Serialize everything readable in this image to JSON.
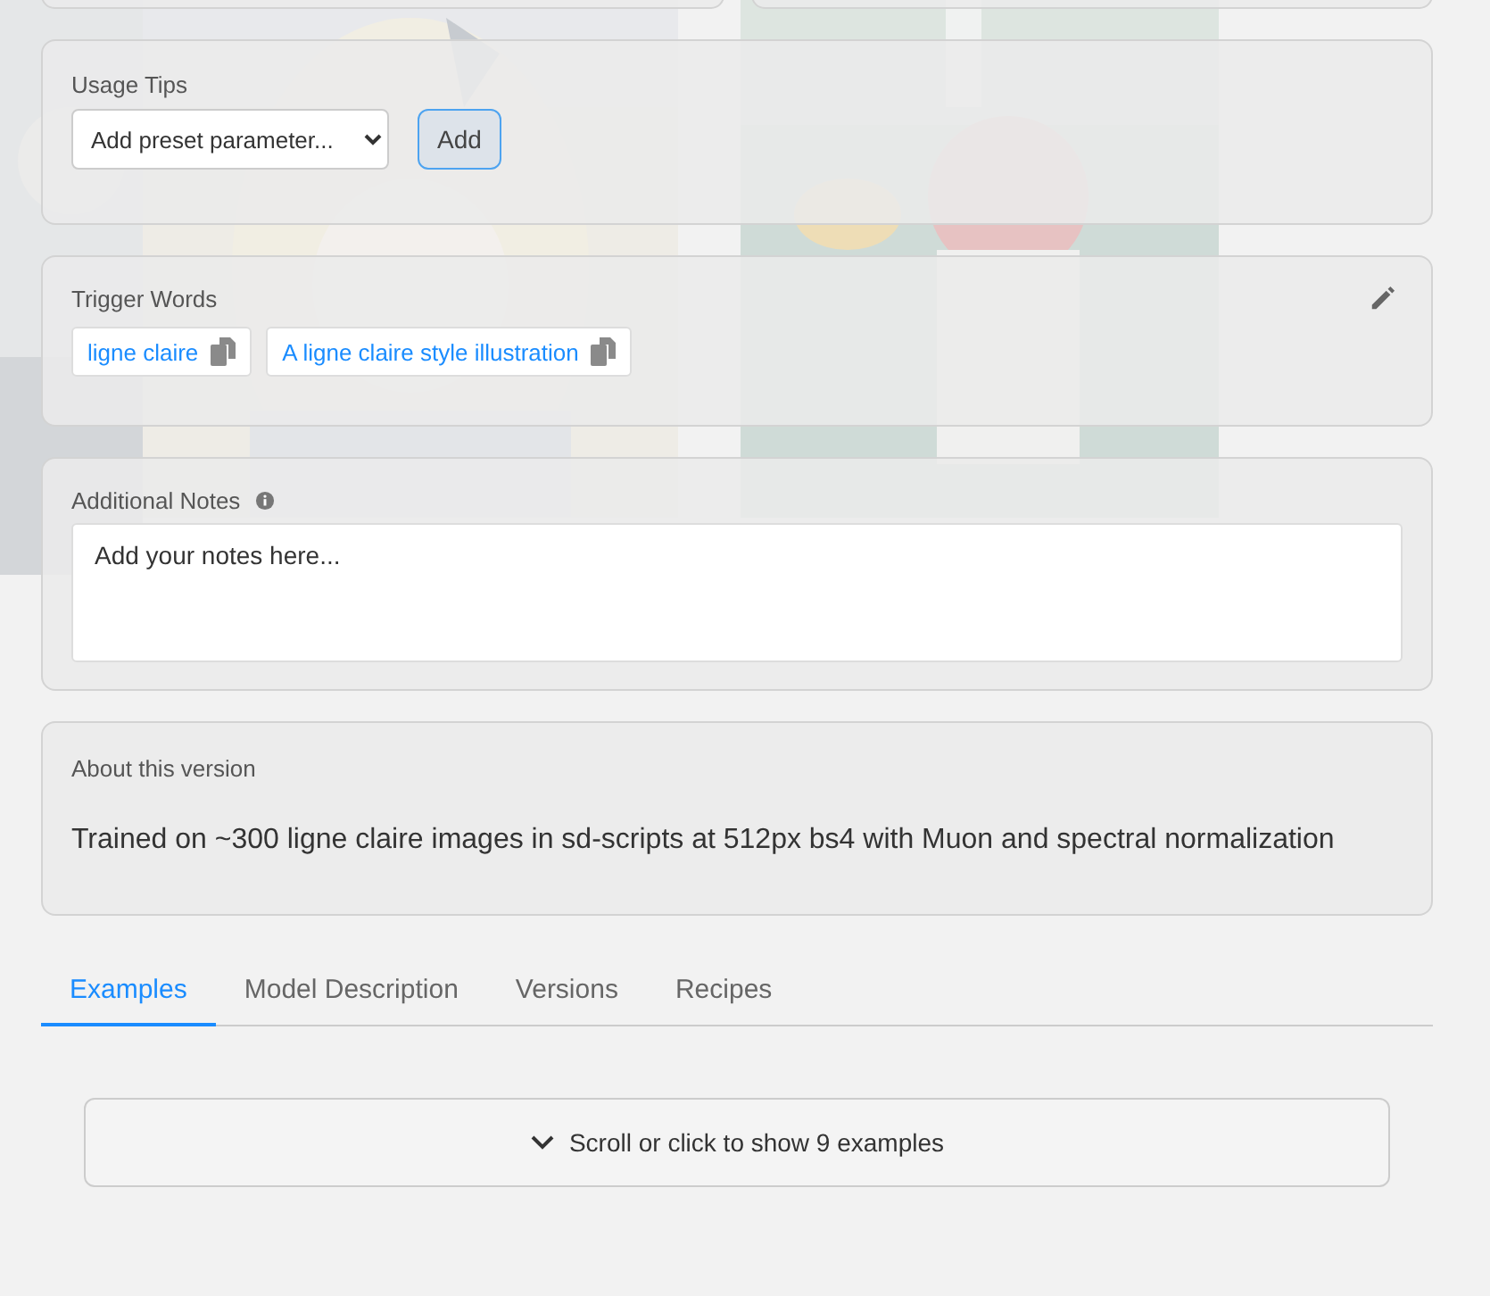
{
  "usage_tips": {
    "label": "Usage Tips",
    "select": {
      "value": "Add preset parameter..."
    },
    "add_button": "Add"
  },
  "trigger_words": {
    "label": "Trigger Words",
    "words": [
      "ligne claire",
      "A ligne claire style illustration"
    ]
  },
  "additional_notes": {
    "label": "Additional Notes",
    "placeholder": "Add your notes here..."
  },
  "about": {
    "title": "About this version",
    "text": "Trained on ~300 ligne claire images in sd-scripts at 512px bs4 with Muon and spectral normalization"
  },
  "tabs": [
    {
      "label": "Examples",
      "selected": true
    },
    {
      "label": "Model Description",
      "selected": false
    },
    {
      "label": "Versions",
      "selected": false
    },
    {
      "label": "Recipes",
      "selected": false
    }
  ],
  "examples_button": "Scroll or click to show 9 examples"
}
